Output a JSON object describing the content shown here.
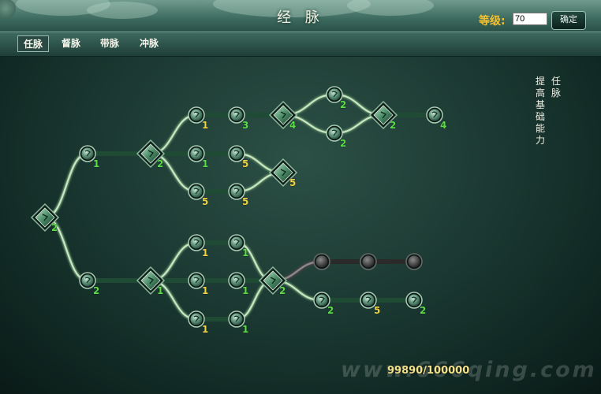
{
  "header": {
    "title": "经 脉",
    "level_label": "等级:",
    "level_value": "70",
    "confirm_label": "确定"
  },
  "tabs": [
    {
      "label": "任脉",
      "active": true
    },
    {
      "label": "督脉",
      "active": false
    },
    {
      "label": "带脉",
      "active": false
    },
    {
      "label": "冲脉",
      "active": false
    }
  ],
  "description": {
    "title": "任脉",
    "text": "提高基础能力"
  },
  "points_display": "99890/100000",
  "watermark": "www.666qing.com",
  "colors": {
    "level_yellow": "#f0c030",
    "number_green": "#5ddc4a",
    "number_yellow": "#f0d24a",
    "link_active": "#c8e6c0",
    "link_locked": "#8a8a8a",
    "node_face": "#3f7b63",
    "diamond_face": "#3a7a5a"
  },
  "nodes": [
    {
      "id": "root",
      "shape": "diamond",
      "icon": "diamond-node-icon",
      "level": "2",
      "color": "green"
    },
    {
      "id": "u1",
      "shape": "circle",
      "icon": "blank-node-icon",
      "level": "1",
      "color": "green"
    },
    {
      "id": "uD",
      "shape": "diamond",
      "icon": "drop-icon",
      "level": "2",
      "color": "green"
    },
    {
      "id": "a1",
      "shape": "circle",
      "icon": "fist-icon",
      "level": "1",
      "color": "yellow"
    },
    {
      "id": "a2",
      "shape": "circle",
      "icon": "leaf-icon",
      "level": "3",
      "color": "green"
    },
    {
      "id": "aD",
      "shape": "diamond",
      "icon": "wing-icon",
      "level": "4",
      "color": "green"
    },
    {
      "id": "a3",
      "shape": "circle",
      "icon": "tablet-icon",
      "level": "2",
      "color": "green"
    },
    {
      "id": "a4",
      "shape": "circle",
      "icon": "blank-node-icon",
      "level": "2",
      "color": "green"
    },
    {
      "id": "aD2",
      "shape": "diamond",
      "icon": "diamond-node-icon",
      "level": "2",
      "color": "green"
    },
    {
      "id": "a5",
      "shape": "circle",
      "icon": "sword-icon",
      "level": "4",
      "color": "green"
    },
    {
      "id": "b1",
      "shape": "circle",
      "icon": "spiral-icon",
      "level": "1",
      "color": "green"
    },
    {
      "id": "b2",
      "shape": "circle",
      "icon": "boot-icon",
      "level": "5",
      "color": "yellow"
    },
    {
      "id": "c1",
      "shape": "circle",
      "icon": "shield-icon",
      "level": "5",
      "color": "yellow"
    },
    {
      "id": "c2",
      "shape": "circle",
      "icon": "feather-icon",
      "level": "5",
      "color": "yellow"
    },
    {
      "id": "bD",
      "shape": "diamond",
      "icon": "gem-icon",
      "level": "5",
      "color": "yellow"
    },
    {
      "id": "d1",
      "shape": "circle",
      "icon": "hammer-icon",
      "level": "2",
      "color": "green"
    },
    {
      "id": "dD",
      "shape": "diamond",
      "icon": "cross-icon",
      "level": "1",
      "color": "green"
    },
    {
      "id": "e1",
      "shape": "circle",
      "icon": "shield-icon",
      "level": "1",
      "color": "yellow"
    },
    {
      "id": "e2",
      "shape": "circle",
      "icon": "blade-icon",
      "level": "1",
      "color": "green"
    },
    {
      "id": "f1",
      "shape": "circle",
      "icon": "spiral-icon",
      "level": "1",
      "color": "yellow"
    },
    {
      "id": "f2",
      "shape": "circle",
      "icon": "leaf-icon",
      "level": "1",
      "color": "green"
    },
    {
      "id": "g1",
      "shape": "circle",
      "icon": "hammer-icon",
      "level": "1",
      "color": "yellow"
    },
    {
      "id": "g2",
      "shape": "circle",
      "icon": "blank-node-icon",
      "level": "1",
      "color": "green"
    },
    {
      "id": "hD",
      "shape": "diamond",
      "icon": "star-icon",
      "level": "2",
      "color": "green"
    },
    {
      "id": "i1",
      "shape": "circle",
      "icon": "locked-node-icon",
      "level": "",
      "color": "green",
      "locked": true
    },
    {
      "id": "i2",
      "shape": "circle",
      "icon": "locked-node-icon",
      "level": "",
      "color": "green",
      "locked": true
    },
    {
      "id": "i3",
      "shape": "circle",
      "icon": "locked-node-icon",
      "level": "",
      "color": "green",
      "locked": true
    },
    {
      "id": "j1",
      "shape": "circle",
      "icon": "blank-node-icon",
      "level": "2",
      "color": "green"
    },
    {
      "id": "j2",
      "shape": "circle",
      "icon": "blank-node-icon",
      "level": "5",
      "color": "yellow"
    },
    {
      "id": "j3",
      "shape": "circle",
      "icon": "claw-icon",
      "level": "2",
      "color": "green"
    }
  ],
  "links": [
    [
      "root",
      "u1"
    ],
    [
      "u1",
      "uD"
    ],
    [
      "uD",
      "a1"
    ],
    [
      "uD",
      "b1"
    ],
    [
      "uD",
      "c1"
    ],
    [
      "a1",
      "a2"
    ],
    [
      "a2",
      "aD"
    ],
    [
      "aD",
      "a3"
    ],
    [
      "aD",
      "a4"
    ],
    [
      "a3",
      "aD2"
    ],
    [
      "a4",
      "aD2"
    ],
    [
      "aD2",
      "a5"
    ],
    [
      "b1",
      "b2"
    ],
    [
      "c1",
      "c2"
    ],
    [
      "b2",
      "bD"
    ],
    [
      "c2",
      "bD"
    ],
    [
      "root",
      "d1"
    ],
    [
      "d1",
      "dD"
    ],
    [
      "dD",
      "e1"
    ],
    [
      "dD",
      "f1"
    ],
    [
      "dD",
      "g1"
    ],
    [
      "e1",
      "e2"
    ],
    [
      "f1",
      "f2"
    ],
    [
      "g1",
      "g2"
    ],
    [
      "e2",
      "hD"
    ],
    [
      "f2",
      "hD"
    ],
    [
      "g2",
      "hD"
    ],
    [
      "hD",
      "i1"
    ],
    [
      "i1",
      "i2"
    ],
    [
      "i2",
      "i3"
    ],
    [
      "hD",
      "j1"
    ],
    [
      "j1",
      "j2"
    ],
    [
      "j2",
      "j3"
    ]
  ]
}
